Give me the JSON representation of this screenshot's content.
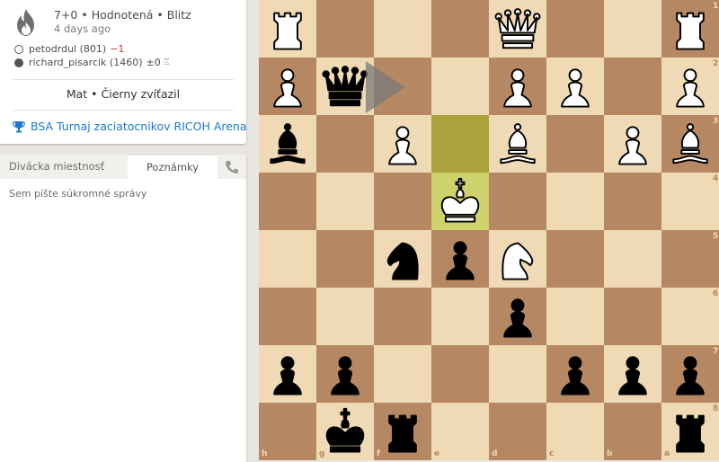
{
  "game": {
    "mode": "7+0 • Hodnotená • Blitz",
    "ago": "4 days ago",
    "white": {
      "name": "petodrdul (801)",
      "diff": "−1"
    },
    "black": {
      "name": "richard_pisarcik (1460)",
      "diff": "±0"
    },
    "result": "Mat • Čierny zvíťazil",
    "tournament": "BSA Turnaj zaciatocnikov RICOH Arena"
  },
  "chat": {
    "tabs": {
      "room": "Divácka miestnosť",
      "notes": "Poznámky"
    },
    "placeholder": "Sem píšte súkromné správy"
  },
  "board": {
    "orientation": "black",
    "files_bottom": [
      "h",
      "g",
      "f",
      "e",
      "d",
      "c",
      "b",
      "a"
    ],
    "ranks_right": [
      "1",
      "2",
      "3",
      "4",
      "5",
      "6",
      "7",
      "8"
    ],
    "last_move": [
      "e4",
      "e3"
    ],
    "pieces": [
      {
        "sq": "h1",
        "piece": "R",
        "color": "w"
      },
      {
        "sq": "d1",
        "piece": "Q",
        "color": "w"
      },
      {
        "sq": "a1",
        "piece": "R",
        "color": "w"
      },
      {
        "sq": "h2",
        "piece": "P",
        "color": "w"
      },
      {
        "sq": "g2",
        "piece": "Q",
        "color": "b"
      },
      {
        "sq": "d2",
        "piece": "P",
        "color": "w"
      },
      {
        "sq": "c2",
        "piece": "P",
        "color": "w"
      },
      {
        "sq": "a2",
        "piece": "P",
        "color": "w"
      },
      {
        "sq": "h3",
        "piece": "B",
        "color": "b"
      },
      {
        "sq": "f3",
        "piece": "P",
        "color": "w"
      },
      {
        "sq": "d3",
        "piece": "B",
        "color": "w"
      },
      {
        "sq": "b3",
        "piece": "P",
        "color": "w"
      },
      {
        "sq": "a3",
        "piece": "B",
        "color": "w"
      },
      {
        "sq": "e4",
        "piece": "K",
        "color": "w"
      },
      {
        "sq": "f5",
        "piece": "N",
        "color": "b"
      },
      {
        "sq": "e5",
        "piece": "P",
        "color": "b"
      },
      {
        "sq": "d5",
        "piece": "N",
        "color": "w"
      },
      {
        "sq": "d6",
        "piece": "P",
        "color": "b"
      },
      {
        "sq": "h7",
        "piece": "P",
        "color": "b"
      },
      {
        "sq": "g7",
        "piece": "P",
        "color": "b"
      },
      {
        "sq": "c7",
        "piece": "P",
        "color": "b"
      },
      {
        "sq": "b7",
        "piece": "P",
        "color": "b"
      },
      {
        "sq": "a7",
        "piece": "P",
        "color": "b"
      },
      {
        "sq": "g8",
        "piece": "K",
        "color": "b"
      },
      {
        "sq": "f8",
        "piece": "R",
        "color": "b"
      },
      {
        "sq": "a8",
        "piece": "R",
        "color": "b"
      }
    ],
    "arrow": {
      "from": "g2",
      "to": "f2",
      "color": "#7a7a7a"
    }
  }
}
